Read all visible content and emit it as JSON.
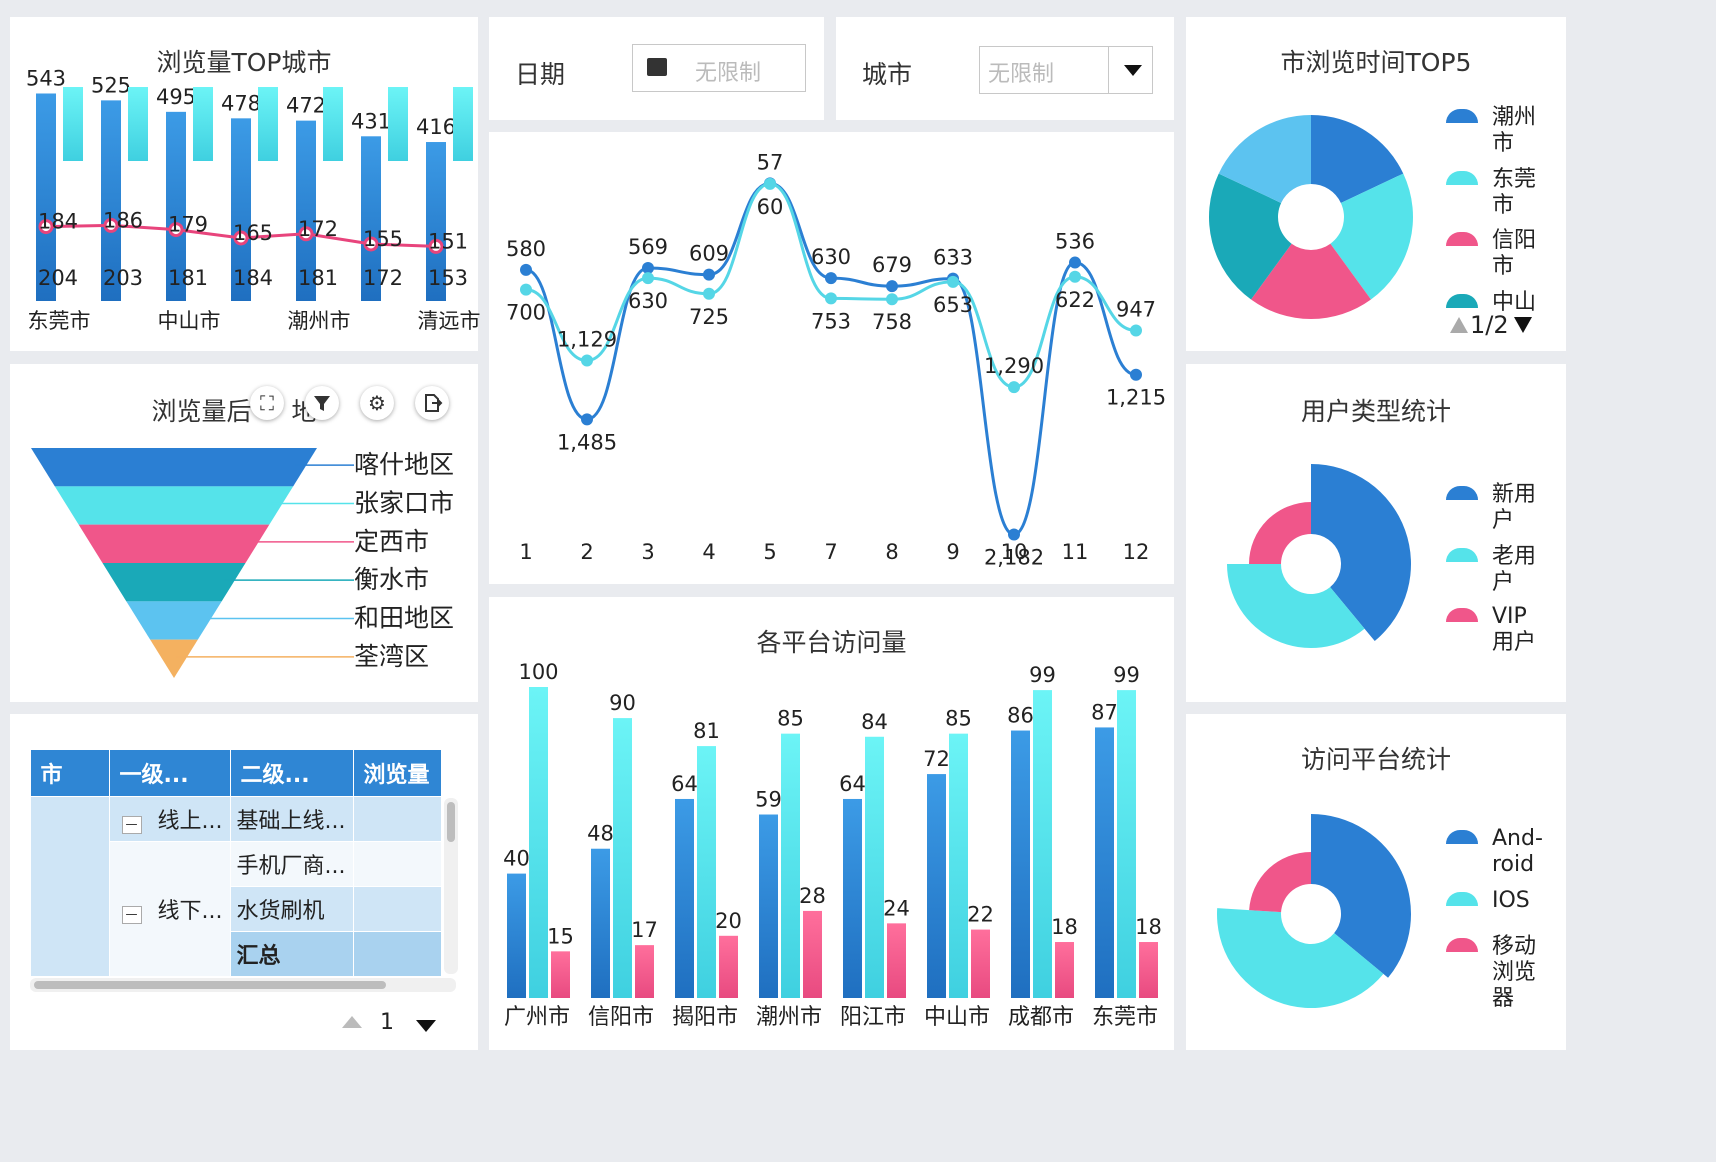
{
  "filters": {
    "date_label": "日期",
    "date_placeholder": "无限制",
    "city_label": "城市",
    "city_placeholder": "无限制"
  },
  "colors": {
    "blue": "#2b7fd3",
    "cyan": "#55e3ea",
    "pink": "#f0568a",
    "teal": "#1aa9b8",
    "lightblue": "#5cc3f0",
    "orange": "#f4b160"
  },
  "chart_data": [
    {
      "id": "top-cities",
      "type": "bar",
      "title": "浏览量TOP城市",
      "categories": [
        "东莞市",
        "",
        "中山市",
        "",
        "潮州市",
        "",
        "清远市"
      ],
      "x_tick_labels": [
        "东莞市",
        "中山市",
        "潮州市",
        "清远市"
      ],
      "series": [
        {
          "kind": "bar",
          "values": [
            543,
            525,
            495,
            478,
            472,
            431,
            416
          ]
        },
        {
          "kind": "bar",
          "values": [
            204,
            203,
            181,
            184,
            181,
            172,
            153
          ]
        },
        {
          "kind": "line",
          "values": [
            184,
            186,
            179,
            165,
            172,
            155,
            151
          ]
        }
      ]
    },
    {
      "id": "monthly-line",
      "type": "line",
      "categories": [
        "1",
        "2",
        "3",
        "4",
        "5",
        "7",
        "8",
        "9",
        "10",
        "11",
        "12"
      ],
      "series": [
        {
          "values": [
            580,
            1485,
            569,
            609,
            57,
            630,
            679,
            633,
            2182,
            536,
            1215
          ]
        },
        {
          "values": [
            700,
            1129,
            630,
            725,
            60,
            753,
            758,
            653,
            1290,
            622,
            947
          ]
        }
      ],
      "y_inverted": true,
      "ylim": [
        0,
        2300
      ]
    },
    {
      "id": "platform-bars",
      "type": "bar",
      "title": "各平台访问量",
      "categories": [
        "广州市",
        "信阳市",
        "揭阳市",
        "潮州市",
        "阳江市",
        "中山市",
        "成都市",
        "东莞市"
      ],
      "series": [
        {
          "values": [
            40,
            48,
            64,
            59,
            64,
            72,
            86,
            87
          ]
        },
        {
          "values": [
            100,
            90,
            81,
            85,
            84,
            85,
            99,
            99
          ]
        },
        {
          "values": [
            15,
            17,
            20,
            28,
            24,
            22,
            18,
            18
          ]
        }
      ],
      "ylim": [
        0,
        100
      ]
    },
    {
      "id": "funnel",
      "type": "funnel",
      "title": "浏览量后五地",
      "title_visible": "浏览量后",
      "title_tail": "地",
      "categories": [
        "喀什地区",
        "张家口市",
        "定西市",
        "衡水市",
        "和田地区",
        "荃湾区"
      ]
    },
    {
      "id": "top5-time",
      "type": "pie",
      "title": "市浏览时间TOP5",
      "legend": [
        "潮州市",
        "东莞市",
        "信阳市",
        "中山"
      ],
      "legend_page": "1/2",
      "values": [
        18,
        22,
        20,
        22,
        18
      ]
    },
    {
      "id": "user-type",
      "type": "pie",
      "title": "用户类型统计",
      "legend": [
        "新用户",
        "老用户",
        "VIP用户"
      ],
      "values": [
        39,
        36,
        25
      ]
    },
    {
      "id": "platform-type",
      "type": "pie",
      "title": "访问平台统计",
      "legend": [
        "And-roid",
        "IOS",
        "移动浏览器"
      ],
      "values": [
        36,
        40,
        24
      ]
    }
  ],
  "table": {
    "headers": [
      "市",
      "一级...",
      "二级...",
      "浏览量"
    ],
    "rows": [
      {
        "l1": "线上...",
        "l2": "基础上线..."
      },
      {
        "l1": "",
        "l2": "手机厂商..."
      },
      {
        "l1": "线下...",
        "l2": "水货刷机"
      },
      {
        "l1": "",
        "l2": "汇总"
      }
    ],
    "collapse_symbol": "—",
    "page": "1"
  }
}
